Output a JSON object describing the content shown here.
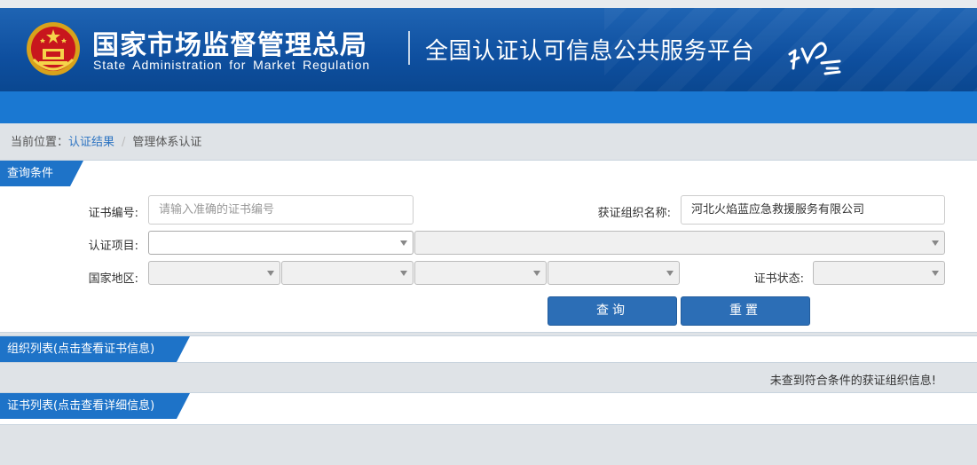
{
  "header": {
    "agency_cn": "国家市场监督管理总局",
    "agency_en": "State Administration  for  Market Regulation",
    "platform_title": "全国认证认可信息公共服务平台",
    "logo_text": "认云",
    "bg_color": "#0e4f9f",
    "nav_color": "#1a78d2"
  },
  "breadcrumb": {
    "prefix": "当前位置：",
    "link": "认证结果",
    "separator": "/",
    "current": "管理体系认证"
  },
  "query": {
    "section_title": "查询条件",
    "cert_no_label": "证书编号:",
    "cert_no_placeholder": "请输入准确的证书编号",
    "org_name_label": "获证组织名称:",
    "org_name_value": "河北火焰蓝应急救援服务有限公司",
    "project_label": "认证项目:",
    "region_label": "国家地区:",
    "status_label": "证书状态:",
    "search_button": "查询",
    "reset_button": "重置"
  },
  "org_list": {
    "title": "组织列表(点击查看证书信息)",
    "empty_message": "未查到符合条件的获证组织信息!"
  },
  "cert_list": {
    "title": "证书列表(点击查看详细信息)"
  },
  "colors": {
    "accent": "#1e73c8",
    "button": "#2c6eb6"
  }
}
